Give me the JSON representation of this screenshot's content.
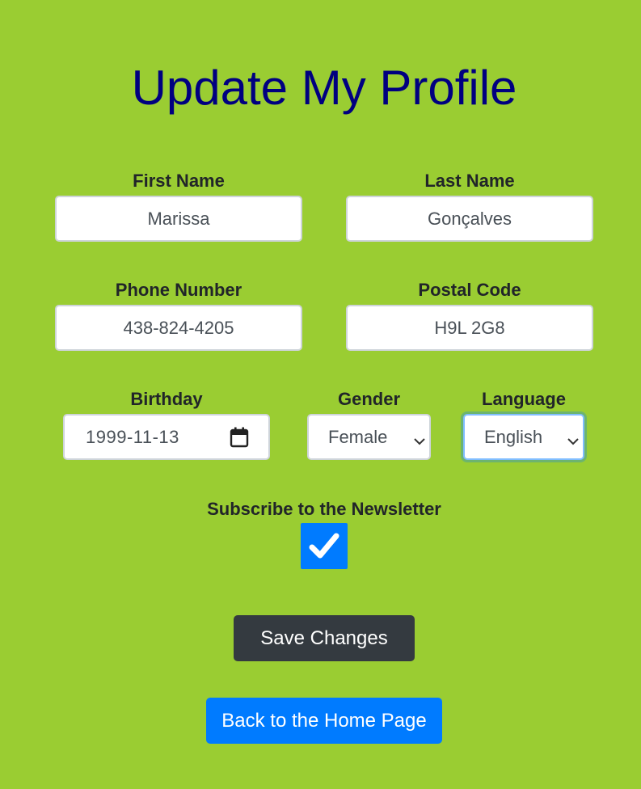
{
  "title": "Update My Profile",
  "fields": {
    "first_name": {
      "label": "First Name",
      "value": "Marissa"
    },
    "last_name": {
      "label": "Last Name",
      "value": "Gonçalves"
    },
    "phone": {
      "label": "Phone Number",
      "value": "438-824-4205"
    },
    "postal_code": {
      "label": "Postal Code",
      "value": "H9L 2G8"
    },
    "birthday": {
      "label": "Birthday",
      "value": "1999-11-13",
      "icon": "calendar-icon"
    },
    "gender": {
      "label": "Gender",
      "selected": "Female",
      "icon": "chevron-down-icon"
    },
    "language": {
      "label": "Language",
      "selected": "English",
      "icon": "chevron-down-icon",
      "focused": true
    }
  },
  "newsletter": {
    "label": "Subscribe to the Newsletter",
    "checked": true,
    "icon": "checkmark-icon"
  },
  "buttons": {
    "save_label": "Save Changes",
    "home_label": "Back to the Home Page"
  },
  "colors": {
    "background": "#9acd32",
    "title": "#000080",
    "save_button": "#343a40",
    "home_button": "#007bff",
    "checkbox": "#007bff"
  }
}
